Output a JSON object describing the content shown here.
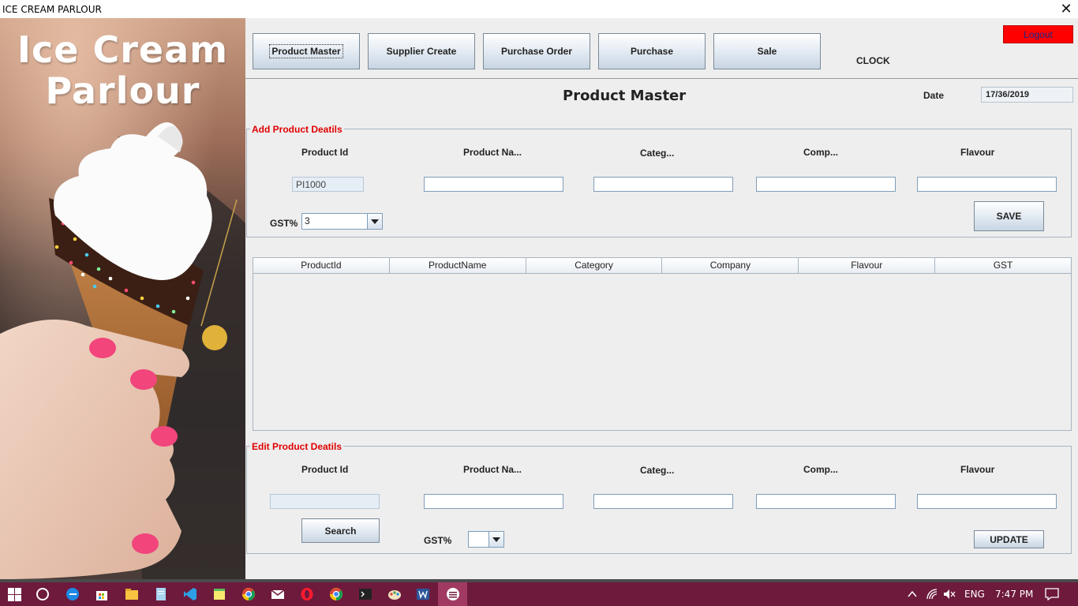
{
  "window": {
    "title": "ICE CREAM PARLOUR",
    "close_glyph": "✕"
  },
  "hero": {
    "brand_line1": "Ice Cream",
    "brand_line2": "Parlour"
  },
  "nav": {
    "buttons": [
      "Product Master",
      "Supplier Create",
      "Purchase Order",
      "Purchase",
      "Sale"
    ],
    "clock": "CLOCK",
    "logout": "Logout"
  },
  "header": {
    "page_title": "Product Master",
    "date_label": "Date",
    "date_value": "17/36/2019"
  },
  "add_section": {
    "legend": "Add Product Deatils",
    "labels": {
      "product_id": "Product Id",
      "product_name": "Product Na...",
      "category": "Categ...",
      "company": "Comp...",
      "flavour": "Flavour"
    },
    "product_id_value": "PI1000",
    "product_name_value": "",
    "category_value": "",
    "company_value": "",
    "flavour_value": "",
    "gst_label": "GST%",
    "gst_value": "3",
    "save_label": "SAVE"
  },
  "table": {
    "columns": [
      "ProductId",
      "ProductName",
      "Category",
      "Company",
      "Flavour",
      "GST"
    ],
    "rows": []
  },
  "edit_section": {
    "legend": "Edit Product Deatils",
    "labels": {
      "product_id": "Product Id",
      "product_name": "Product Na...",
      "category": "Categ...",
      "company": "Comp...",
      "flavour": "Flavour"
    },
    "product_id_value": "",
    "product_name_value": "",
    "category_value": "",
    "company_value": "",
    "flavour_value": "",
    "search_label": "Search",
    "gst_label": "GST%",
    "gst_value": "",
    "update_label": "UPDATE"
  },
  "taskbar": {
    "icons": [
      "windows-start-icon",
      "cortana-icon",
      "edge-icon",
      "store-icon",
      "file-explorer-icon",
      "notepad-icon",
      "vscode-icon",
      "sticky-notes-icon",
      "chrome-icon",
      "mail-icon",
      "opera-icon",
      "chrome-icon",
      "terminal-icon",
      "paint-icon",
      "word-icon",
      "java-app-icon"
    ],
    "language": "ENG",
    "time": "7:47 PM"
  },
  "colors": {
    "legend_red": "#e00000",
    "logout_red": "#ff0000",
    "taskbar": "#6e1a3c",
    "panel": "#eeeeee"
  }
}
